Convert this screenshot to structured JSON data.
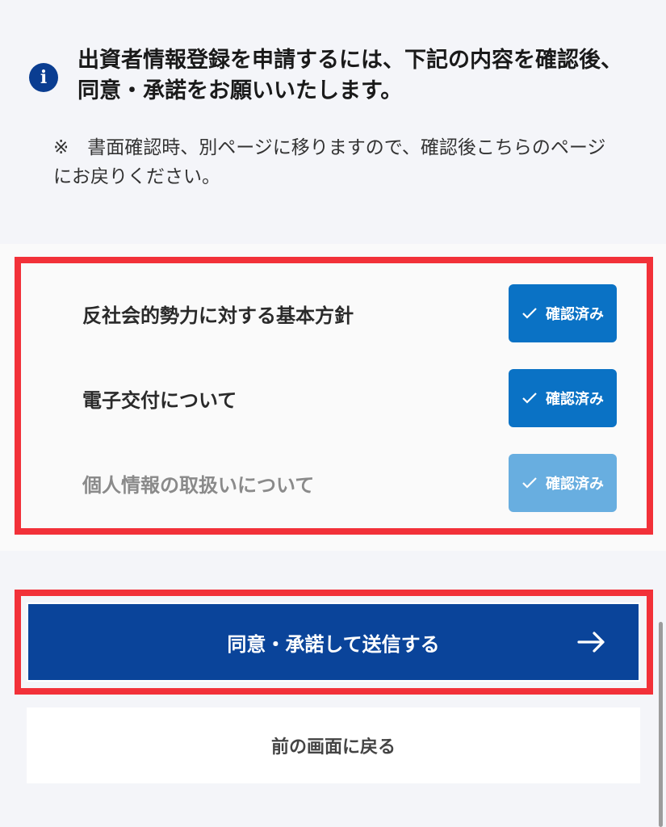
{
  "notice": {
    "icon": "info-icon",
    "title": "出資者情報登録を申請するには、下記の内容を確認後、同意・承諾をお願いいたします。",
    "note": "※　書面確認時、別ページに移りますので、確認後こちらのページにお戻りください。"
  },
  "checks": {
    "items": [
      {
        "label": "反社会的勢力に対する基本方針",
        "status": "確認済み"
      },
      {
        "label": "電子交付について",
        "status": "確認済み"
      },
      {
        "label": "個人情報の取扱いについて",
        "status": "確認済み"
      }
    ]
  },
  "actions": {
    "submit_label": "同意・承諾して送信する",
    "back_label": "前の画面に戻る"
  },
  "colors": {
    "primary": "#0a449a",
    "confirmed": "#0a72c5",
    "confirmed_light": "#68aee0",
    "highlight": "#f23139"
  }
}
